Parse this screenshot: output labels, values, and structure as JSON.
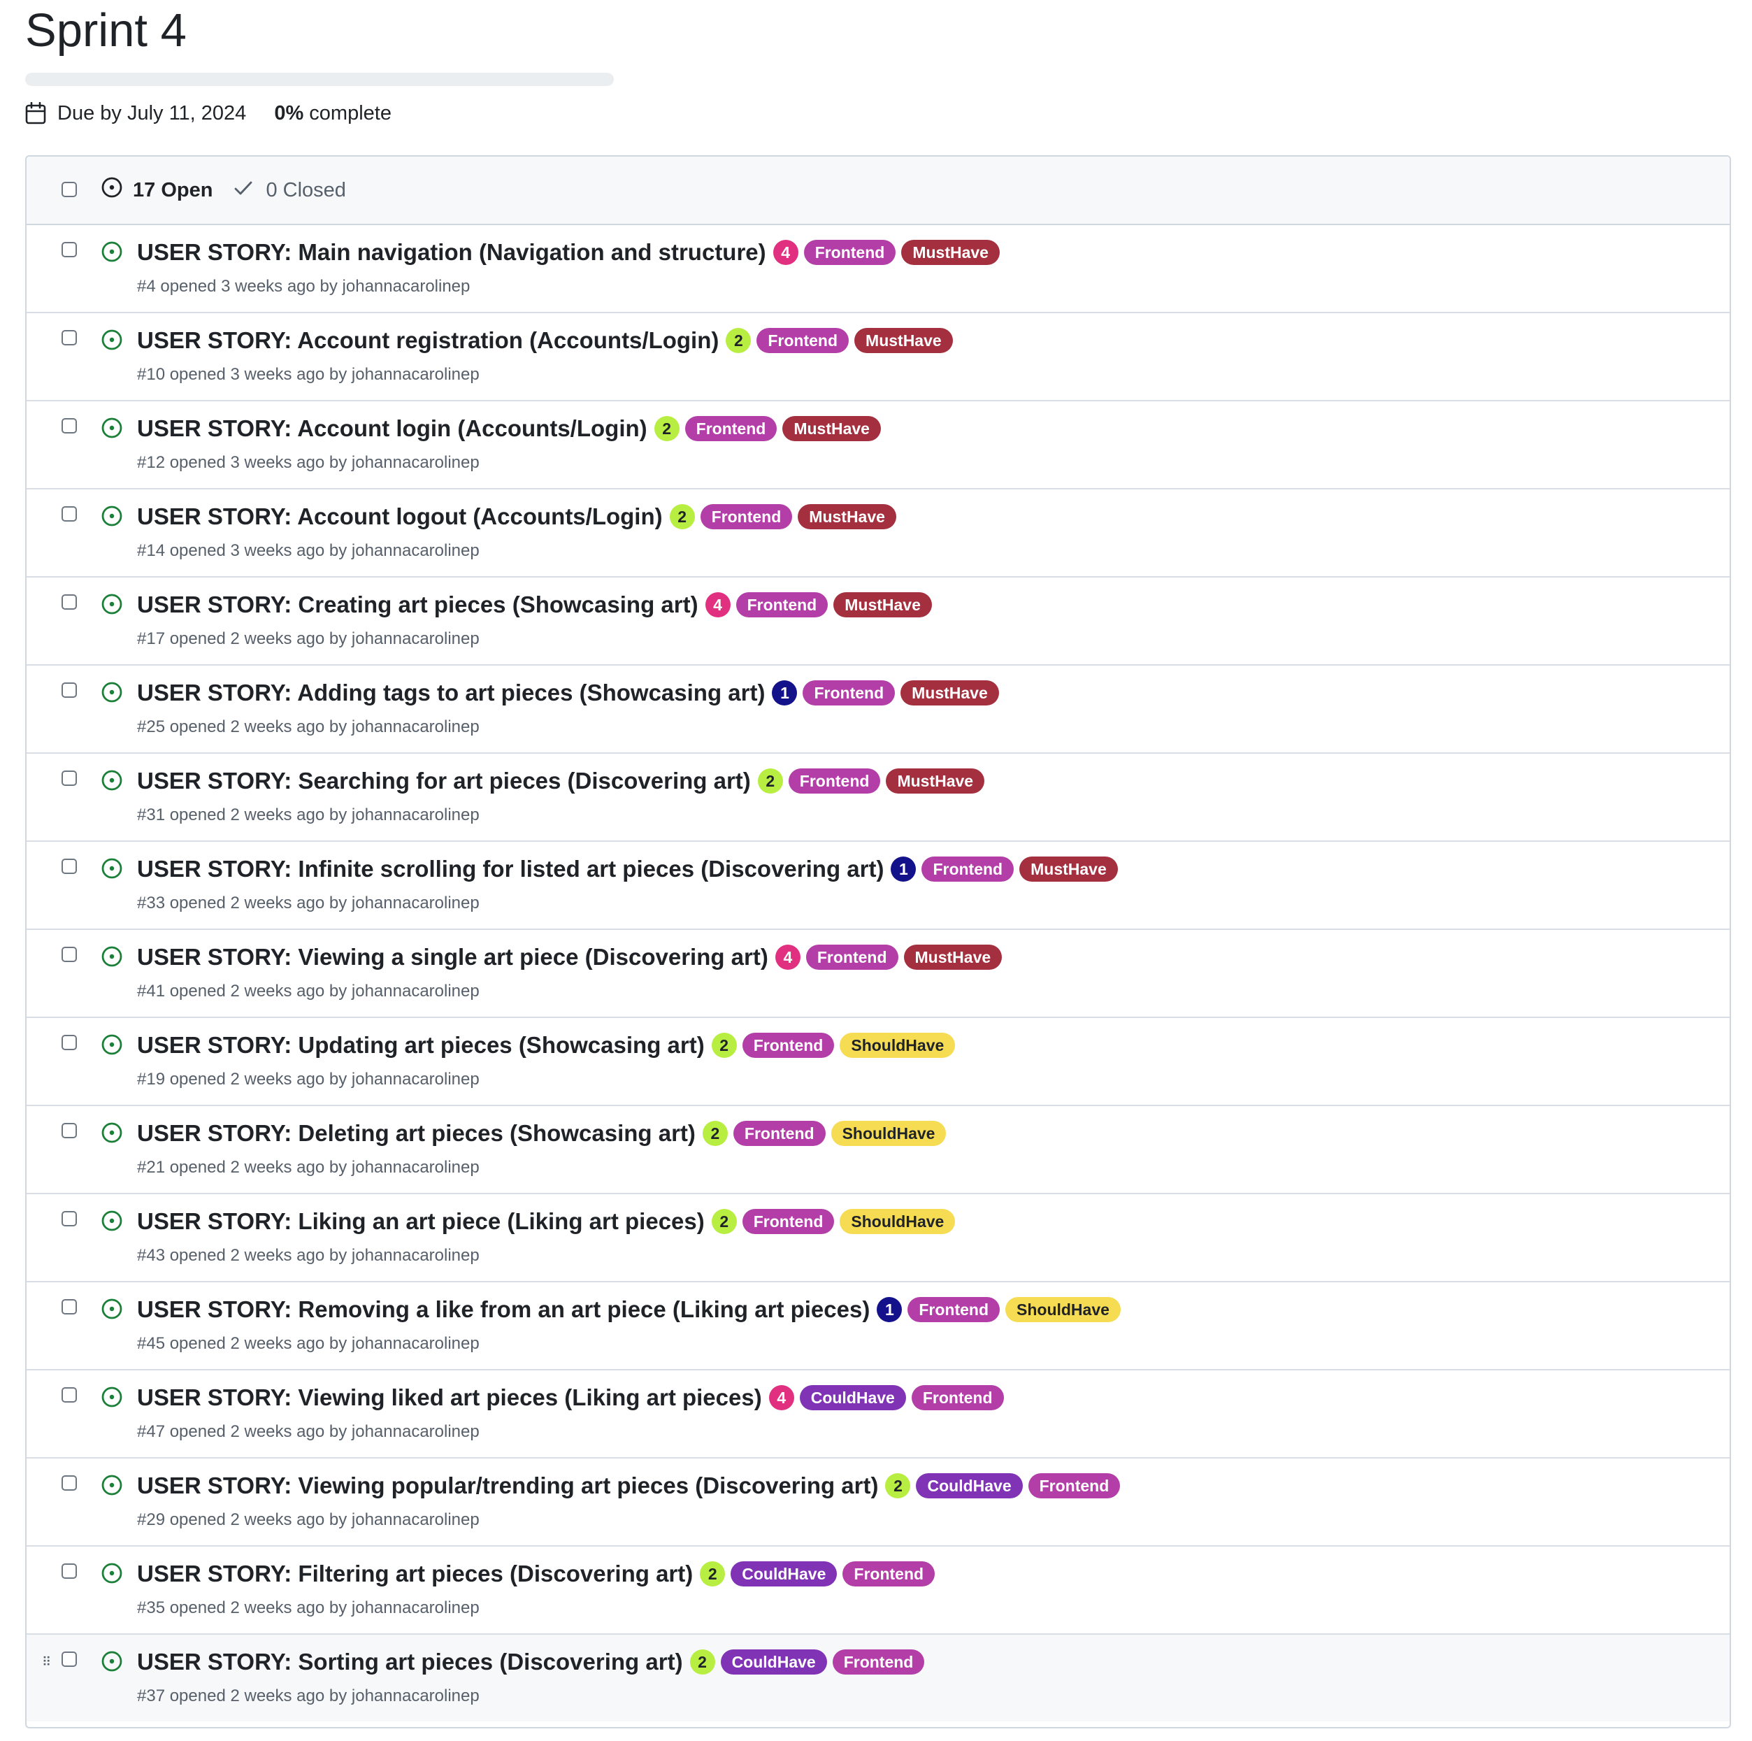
{
  "milestone": {
    "title": "Sprint 4",
    "progress": 0,
    "due": "Due by July 11, 2024",
    "percent": "0%",
    "percent_suffix": " complete"
  },
  "header": {
    "open_count": "17 Open",
    "closed_count": "0 Closed"
  },
  "label_colors": {
    "Frontend": {
      "bg": "#b33ea8",
      "fg": "#ffffff"
    },
    "MustHave": {
      "bg": "#a4303f",
      "fg": "#ffffff"
    },
    "ShouldHave": {
      "bg": "#f5dc52",
      "fg": "#1f2328"
    },
    "CouldHave": {
      "bg": "#8133b5",
      "fg": "#ffffff"
    },
    "1": {
      "bg": "#13128a",
      "fg": "#ffffff"
    },
    "2": {
      "bg": "#b8ee41",
      "fg": "#1f2328"
    },
    "4": {
      "bg": "#e0307f",
      "fg": "#ffffff"
    }
  },
  "issues": [
    {
      "title": "USER STORY: Main navigation (Navigation and structure)",
      "labels": [
        "4",
        "Frontend",
        "MustHave"
      ],
      "meta": "#4 opened 3 weeks ago by johannacarolinep"
    },
    {
      "title": "USER STORY: Account registration (Accounts/Login)",
      "labels": [
        "2",
        "Frontend",
        "MustHave"
      ],
      "meta": "#10 opened 3 weeks ago by johannacarolinep"
    },
    {
      "title": "USER STORY: Account login (Accounts/Login)",
      "labels": [
        "2",
        "Frontend",
        "MustHave"
      ],
      "meta": "#12 opened 3 weeks ago by johannacarolinep"
    },
    {
      "title": "USER STORY: Account logout (Accounts/Login)",
      "labels": [
        "2",
        "Frontend",
        "MustHave"
      ],
      "meta": "#14 opened 3 weeks ago by johannacarolinep"
    },
    {
      "title": "USER STORY: Creating art pieces (Showcasing art)",
      "labels": [
        "4",
        "Frontend",
        "MustHave"
      ],
      "meta": "#17 opened 2 weeks ago by johannacarolinep"
    },
    {
      "title": "USER STORY: Adding tags to art pieces (Showcasing art)",
      "labels": [
        "1",
        "Frontend",
        "MustHave"
      ],
      "meta": "#25 opened 2 weeks ago by johannacarolinep"
    },
    {
      "title": "USER STORY: Searching for art pieces (Discovering art)",
      "labels": [
        "2",
        "Frontend",
        "MustHave"
      ],
      "meta": "#31 opened 2 weeks ago by johannacarolinep"
    },
    {
      "title": "USER STORY: Infinite scrolling for listed art pieces (Discovering art)",
      "labels": [
        "1",
        "Frontend",
        "MustHave"
      ],
      "meta": "#33 opened 2 weeks ago by johannacarolinep"
    },
    {
      "title": "USER STORY: Viewing a single art piece (Discovering art)",
      "labels": [
        "4",
        "Frontend",
        "MustHave"
      ],
      "meta": "#41 opened 2 weeks ago by johannacarolinep"
    },
    {
      "title": "USER STORY: Updating art pieces (Showcasing art)",
      "labels": [
        "2",
        "Frontend",
        "ShouldHave"
      ],
      "meta": "#19 opened 2 weeks ago by johannacarolinep"
    },
    {
      "title": "USER STORY: Deleting art pieces (Showcasing art)",
      "labels": [
        "2",
        "Frontend",
        "ShouldHave"
      ],
      "meta": "#21 opened 2 weeks ago by johannacarolinep"
    },
    {
      "title": "USER STORY: Liking an art piece (Liking art pieces)",
      "labels": [
        "2",
        "Frontend",
        "ShouldHave"
      ],
      "meta": "#43 opened 2 weeks ago by johannacarolinep"
    },
    {
      "title": "USER STORY: Removing a like from an art piece (Liking art pieces)",
      "labels": [
        "1",
        "Frontend",
        "ShouldHave"
      ],
      "meta": "#45 opened 2 weeks ago by johannacarolinep"
    },
    {
      "title": "USER STORY: Viewing liked art pieces (Liking art pieces)",
      "labels": [
        "4",
        "CouldHave",
        "Frontend"
      ],
      "meta": "#47 opened 2 weeks ago by johannacarolinep"
    },
    {
      "title": "USER STORY: Viewing popular/trending art pieces (Discovering art)",
      "labels": [
        "2",
        "CouldHave",
        "Frontend"
      ],
      "meta": "#29 opened 2 weeks ago by johannacarolinep"
    },
    {
      "title": "USER STORY: Filtering art pieces (Discovering art)",
      "labels": [
        "2",
        "CouldHave",
        "Frontend"
      ],
      "meta": "#35 opened 2 weeks ago by johannacarolinep"
    },
    {
      "title": "USER STORY: Sorting art pieces (Discovering art)",
      "labels": [
        "2",
        "CouldHave",
        "Frontend"
      ],
      "meta": "#37 opened 2 weeks ago by johannacarolinep",
      "hovered": true
    }
  ],
  "icons": {
    "due": "calendar-icon",
    "open": "issue-opened-icon",
    "closed": "check-icon",
    "drag": "drag-handle-icon"
  }
}
